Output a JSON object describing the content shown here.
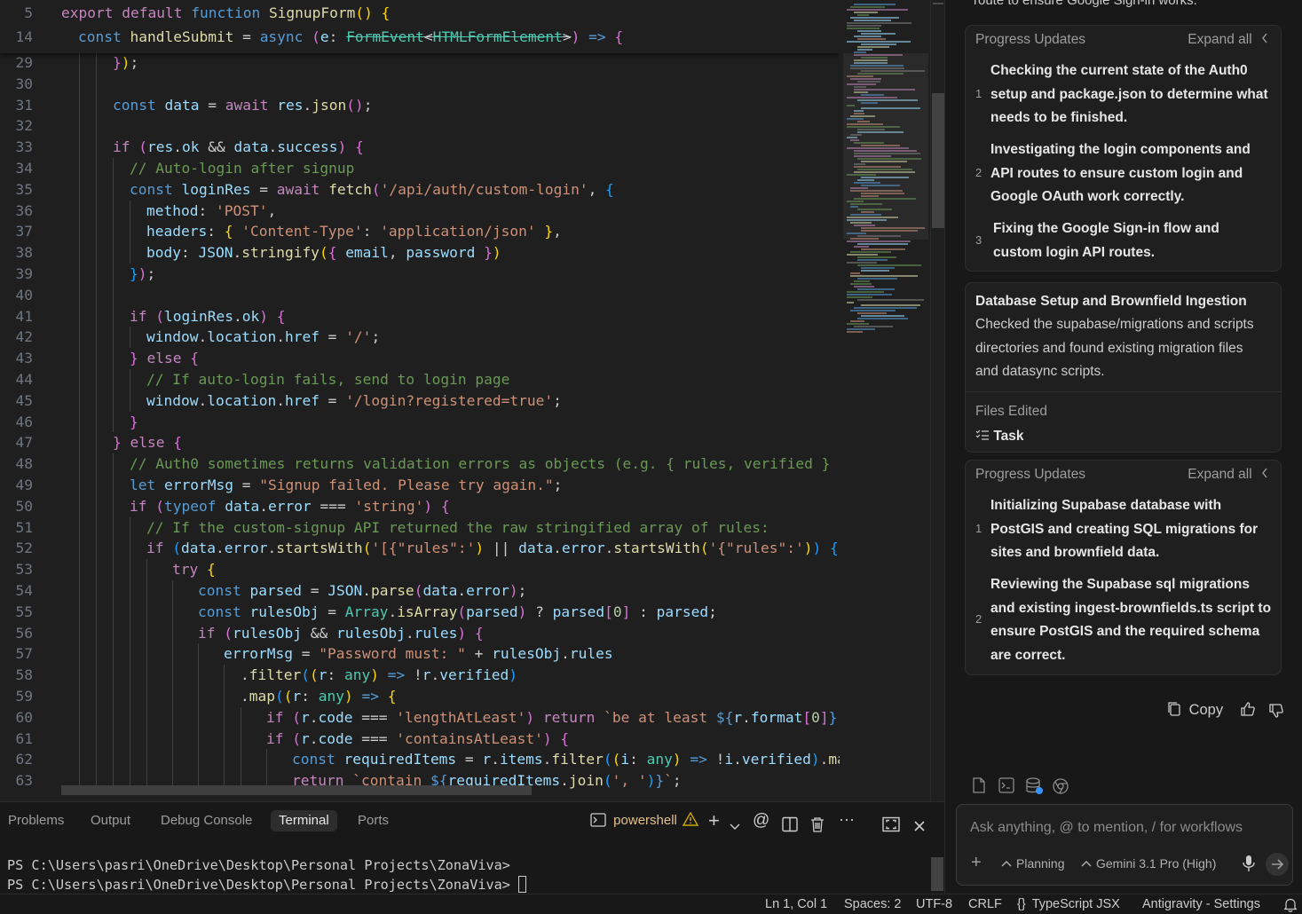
{
  "editor": {
    "sticky": [
      {
        "num": "5",
        "code": "export default function SignupForm() {"
      },
      {
        "num": "14",
        "code": "const handleSubmit = async (e: FormEvent<HTMLFormElement>) => {"
      }
    ],
    "lines": [
      {
        "num": "29",
        "code": "});"
      },
      {
        "num": "30",
        "code": ""
      },
      {
        "num": "31",
        "code": "const data = await res.json();"
      },
      {
        "num": "32",
        "code": ""
      },
      {
        "num": "33",
        "code": "if (res.ok && data.success) {"
      },
      {
        "num": "34",
        "code": "// Auto-login after signup"
      },
      {
        "num": "35",
        "code": "const loginRes = await fetch('/api/auth/custom-login', {"
      },
      {
        "num": "36",
        "code": "method: 'POST',"
      },
      {
        "num": "37",
        "code": "headers: { 'Content-Type': 'application/json' },"
      },
      {
        "num": "38",
        "code": "body: JSON.stringify({ email, password })"
      },
      {
        "num": "39",
        "code": "});"
      },
      {
        "num": "40",
        "code": ""
      },
      {
        "num": "41",
        "code": "if (loginRes.ok) {"
      },
      {
        "num": "42",
        "code": "window.location.href = '/';"
      },
      {
        "num": "43",
        "code": "} else {"
      },
      {
        "num": "44",
        "code": "// If auto-login fails, send to login page"
      },
      {
        "num": "45",
        "code": "window.location.href = '/login?registered=true';"
      },
      {
        "num": "46",
        "code": "}"
      },
      {
        "num": "47",
        "code": "} else {"
      },
      {
        "num": "48",
        "code": "// Auth0 sometimes returns validation errors as objects (e.g. { rules, verified } o"
      },
      {
        "num": "49",
        "code": "let errorMsg = \"Signup failed. Please try again.\";"
      },
      {
        "num": "50",
        "code": "if (typeof data.error === 'string') {"
      },
      {
        "num": "51",
        "code": "// If the custom-signup API returned the raw stringified array of rules:"
      },
      {
        "num": "52",
        "code": "if (data.error.startsWith('[{\"rules\":') || data.error.startsWith('{\"rules\":')) {"
      },
      {
        "num": "53",
        "code": "try {"
      },
      {
        "num": "54",
        "code": "const parsed = JSON.parse(data.error);"
      },
      {
        "num": "55",
        "code": "const rulesObj = Array.isArray(parsed) ? parsed[0] : parsed;"
      },
      {
        "num": "56",
        "code": "if (rulesObj && rulesObj.rules) {"
      },
      {
        "num": "57",
        "code": "errorMsg = \"Password must: \" + rulesObj.rules"
      },
      {
        "num": "58",
        "code": ".filter((r: any) => !r.verified)"
      },
      {
        "num": "59",
        "code": ".map((r: any) => {"
      },
      {
        "num": "60",
        "code": "if (r.code === 'lengthAtLeast') return `be at least ${r.format[0]}"
      },
      {
        "num": "61",
        "code": "if (r.code === 'containsAtLeast') {"
      },
      {
        "num": "62",
        "code": "const requiredItems = r.items.filter((i: any) => !i.verified).ma"
      },
      {
        "num": "63",
        "code": "return `contain ${requiredItems.join(', ')}`;"
      }
    ]
  },
  "panel": {
    "tabs": [
      "Problems",
      "Output",
      "Debug Console",
      "Terminal",
      "Ports"
    ],
    "active_tab": "Terminal",
    "shell_label": "powershell",
    "terminal_lines": [
      "PS C:\\Users\\pasri\\OneDrive\\Desktop\\Personal Projects\\ZonaViva>",
      "PS C:\\Users\\pasri\\OneDrive\\Desktop\\Personal Projects\\ZonaViva>"
    ]
  },
  "agent": {
    "top_snippet": "route to ensure Google Sign-in works.",
    "progress1": {
      "header": "Progress Updates",
      "expand": "Expand all",
      "steps": [
        {
          "num": "1",
          "text": "Checking the current state of the Auth0 setup and package.json to determine what needs to be finished."
        },
        {
          "num": "2",
          "text": "Investigating the login components and API routes to ensure custom login and Google OAuth work correctly."
        },
        {
          "num": "3",
          "text": "Fixing the Google Sign-in flow and custom login API routes."
        }
      ]
    },
    "section": {
      "title": "Database Setup and Brownfield Ingestion",
      "body": "Checked the supabase/migrations and scripts directories and found existing migration files and datasync scripts.",
      "files_label": "Files Edited",
      "file": "Task"
    },
    "progress2": {
      "header": "Progress Updates",
      "expand": "Expand all",
      "steps": [
        {
          "num": "1",
          "text": "Initializing Supabase database with PostGIS and creating SQL migrations for sites and brownfield data."
        },
        {
          "num": "2",
          "text": "Reviewing the Supabase sql migrations and existing ingest-brownfields.ts script to ensure PostGIS and the required schema are correct."
        }
      ]
    },
    "copy_label": "Copy",
    "chat": {
      "placeholder": "Ask anything, @ to mention, / for workflows",
      "mode": "Planning",
      "model": "Gemini 3.1 Pro (High)"
    }
  },
  "status": {
    "position": "Ln 1, Col 1",
    "spaces": "Spaces: 2",
    "encoding": "UTF-8",
    "eol": "CRLF",
    "language": "TypeScript JSX",
    "settings": "Antigravity - Settings"
  },
  "colors": {
    "background": "#1f1f1f",
    "keyword": "#569cd6",
    "control": "#c586c0",
    "function": "#dcdcaa",
    "variable": "#9cdcfe",
    "string": "#ce9178",
    "comment": "#6a9955",
    "type": "#4ec9b0",
    "warning": "#cca700"
  }
}
